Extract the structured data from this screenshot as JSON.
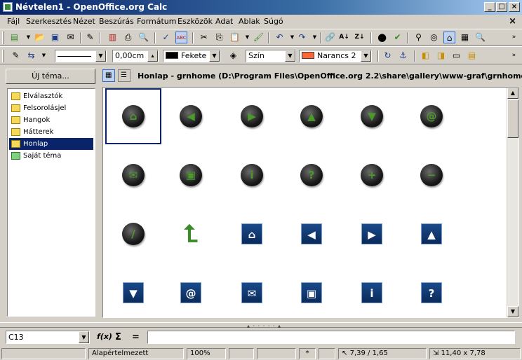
{
  "window": {
    "title": "Névtelen1 - OpenOffice.org Calc",
    "minimize": "_",
    "maximize": "□",
    "close": "×"
  },
  "menu": {
    "items": [
      "Fájl",
      "Szerkesztés",
      "Nézet",
      "Beszúrás",
      "Formátum",
      "Eszközök",
      "Adat",
      "Ablak",
      "Súgó"
    ],
    "doc_close": "×"
  },
  "toolbar2": {
    "line_width": "0,00cm",
    "line_color": "Fekete",
    "line_color_hex": "#000000",
    "area_style": "Szín",
    "fill_color": "Narancs 2",
    "fill_color_hex": "#ff6633"
  },
  "gallery": {
    "new_theme_label": "Új téma...",
    "themes": [
      {
        "label": "Elválasztók",
        "icon": "folder-icon"
      },
      {
        "label": "Felsorolásjel",
        "icon": "folder-icon"
      },
      {
        "label": "Hangok",
        "icon": "folder-icon"
      },
      {
        "label": "Hátterek",
        "icon": "folder-icon"
      },
      {
        "label": "Honlap",
        "icon": "folder-icon",
        "selected": true
      },
      {
        "label": "Saját téma",
        "icon": "folder-green-icon"
      }
    ],
    "path": "Honlap - grnhome (D:\\Program Files\\OpenOffice.org 2.2\\share\\gallery\\www-graf\\grnhome.gif)",
    "items": [
      {
        "name": "home-ball-icon",
        "style": "ball",
        "glyph": "⌂"
      },
      {
        "name": "left-ball-icon",
        "style": "ball",
        "glyph": "◀"
      },
      {
        "name": "right-ball-icon",
        "style": "ball",
        "glyph": "▶"
      },
      {
        "name": "up-ball-icon",
        "style": "ball",
        "glyph": "▲"
      },
      {
        "name": "down-ball-icon",
        "style": "ball",
        "glyph": "▼"
      },
      {
        "name": "at-ball-icon",
        "style": "ball",
        "glyph": "@"
      },
      {
        "name": "mail-ball-icon",
        "style": "ball",
        "glyph": "✉"
      },
      {
        "name": "save-ball-icon",
        "style": "ball",
        "glyph": "▣"
      },
      {
        "name": "info-ball-icon",
        "style": "ball",
        "glyph": "i"
      },
      {
        "name": "question-ball-icon",
        "style": "ball",
        "glyph": "?"
      },
      {
        "name": "plus-ball-icon",
        "style": "ball",
        "glyph": "+"
      },
      {
        "name": "minus-ball-icon",
        "style": "ball",
        "glyph": "−"
      },
      {
        "name": "slash-ball-icon",
        "style": "ball",
        "glyph": "/"
      },
      {
        "name": "green-up-arrow-icon",
        "style": "arrow",
        "glyph": "⮤"
      },
      {
        "name": "home-square-icon",
        "style": "square",
        "glyph": "⌂"
      },
      {
        "name": "left-square-icon",
        "style": "square",
        "glyph": "◀"
      },
      {
        "name": "right-square-icon",
        "style": "square",
        "glyph": "▶"
      },
      {
        "name": "up-square-icon",
        "style": "square",
        "glyph": "▲"
      },
      {
        "name": "down-square-icon",
        "style": "square",
        "glyph": "▼"
      },
      {
        "name": "at-square-icon",
        "style": "square",
        "glyph": "@"
      },
      {
        "name": "mail-square-icon",
        "style": "square",
        "glyph": "✉"
      },
      {
        "name": "save-square-icon",
        "style": "square",
        "glyph": "▣"
      },
      {
        "name": "info-square-icon",
        "style": "square",
        "glyph": "i"
      },
      {
        "name": "question-square-icon",
        "style": "square",
        "glyph": "?"
      }
    ]
  },
  "formula_bar": {
    "cell_ref": "C13",
    "function_wizard": "f(x)",
    "sum": "Σ",
    "equals": "=",
    "formula": ""
  },
  "status_bar": {
    "page_style": "Alapértelmezett",
    "zoom": "100%",
    "modified": "*",
    "position": "7,39 / 1,65",
    "size": "11,40 x 7,78"
  }
}
